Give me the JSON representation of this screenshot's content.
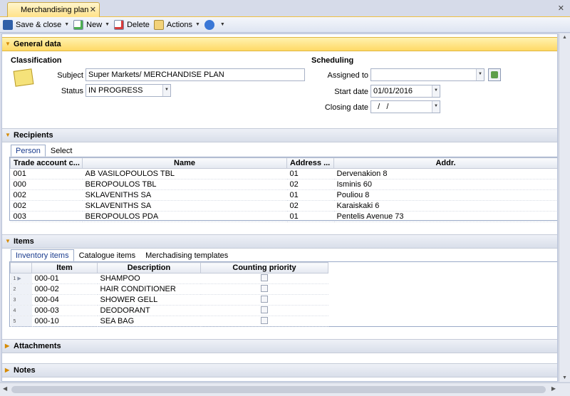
{
  "tab": {
    "title": "Merchandising plan",
    "close": "✕"
  },
  "window": {
    "close": "✕"
  },
  "toolbar": {
    "save_close": "Save & close",
    "new": "New",
    "delete": "Delete",
    "actions": "Actions"
  },
  "general": {
    "title": "General data",
    "classification": "Classification",
    "subject_label": "Subject",
    "subject_value": "Super Markets/ MERCHANDISE PLAN",
    "status_label": "Status",
    "status_value": "IN PROGRESS",
    "scheduling": "Scheduling",
    "assigned_label": "Assigned to",
    "assigned_value": "",
    "start_label": "Start date",
    "start_value": "01/01/2016",
    "closing_label": "Closing date",
    "closing_value": "  /   /"
  },
  "recipients": {
    "title": "Recipients",
    "tabs": [
      "Person",
      "Select"
    ],
    "columns": [
      "Trade account c...",
      "Name",
      "Address ...",
      "Addr."
    ],
    "rows": [
      [
        "001",
        "AB VASILOPOULOS TBL",
        "01",
        "Dervenakion 8"
      ],
      [
        "000",
        "BEROPOULOS TBL",
        "02",
        "Isminis 60"
      ],
      [
        "002",
        "SKLAVENITHS SA",
        "01",
        "Pouliou 8"
      ],
      [
        "002",
        "SKLAVENITHS SA",
        "02",
        "Karaiskaki 6"
      ],
      [
        "003",
        "BEROPOULOS PDA",
        "01",
        "Pentelis Avenue 73"
      ]
    ]
  },
  "items": {
    "title": "Items",
    "tabs": [
      "Inventory items",
      "Catalogue items",
      "Merchadising templates"
    ],
    "columns": [
      "Item",
      "Description",
      "Counting priority"
    ],
    "rows": [
      [
        "1",
        "000-01",
        "SHAMPOO"
      ],
      [
        "2",
        "000-02",
        "HAIR CONDITIONER"
      ],
      [
        "3",
        "000-04",
        "SHOWER GELL"
      ],
      [
        "4",
        "000-03",
        "DEODORANT"
      ],
      [
        "5",
        "000-10",
        "SEA BAG"
      ]
    ]
  },
  "attachments": {
    "title": "Attachments"
  },
  "notes": {
    "title": "Notes"
  }
}
